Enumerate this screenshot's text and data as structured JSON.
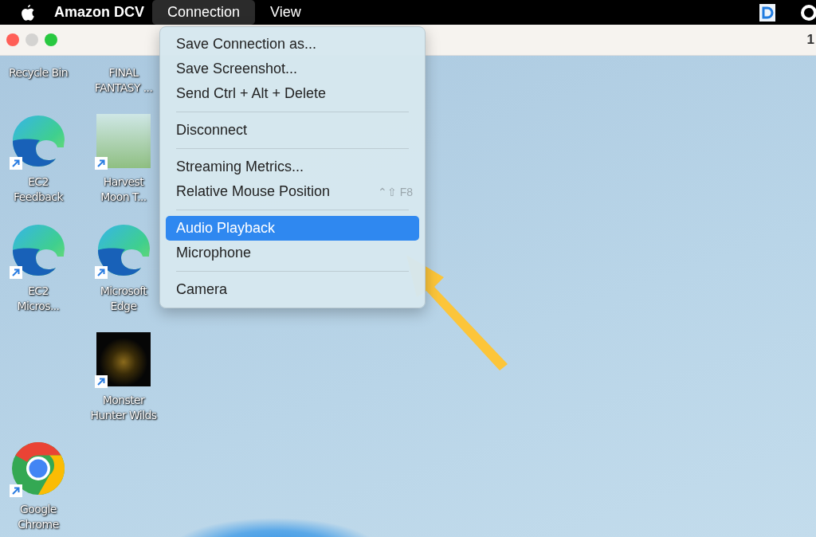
{
  "menubar": {
    "app_name": "Amazon DCV",
    "menus": [
      {
        "label": "Connection",
        "selected": true
      },
      {
        "label": "View",
        "selected": false
      }
    ]
  },
  "titlebar": {
    "right_text": "1"
  },
  "desktop": {
    "shortcuts": [
      {
        "label": "Recycle Bin",
        "kind": "clipped"
      },
      {
        "label": "FINAL\nFANTASY ...",
        "kind": "clipped"
      },
      {
        "label": "EC2\nFeedback",
        "kind": "edge"
      },
      {
        "label": "Harvest\nMoon T...",
        "kind": "photo"
      },
      {
        "label": "EC2\nMicros...",
        "kind": "edge"
      },
      {
        "label": "Microsoft\nEdge",
        "kind": "edge"
      },
      {
        "label": "Monster\nHunter Wilds",
        "kind": "darkphoto"
      },
      {
        "label": "Google\nChrome",
        "kind": "chrome"
      }
    ]
  },
  "menu": {
    "items": [
      {
        "kind": "item",
        "label": "Save Connection as...",
        "selected": false
      },
      {
        "kind": "item",
        "label": "Save Screenshot...",
        "selected": false
      },
      {
        "kind": "item",
        "label": "Send Ctrl + Alt + Delete",
        "selected": false
      },
      {
        "kind": "separator"
      },
      {
        "kind": "item",
        "label": "Disconnect",
        "selected": false
      },
      {
        "kind": "separator"
      },
      {
        "kind": "item",
        "label": "Streaming Metrics...",
        "selected": false
      },
      {
        "kind": "item",
        "label": "Relative Mouse Position",
        "shortcut": "⌃⇧ F8",
        "selected": false
      },
      {
        "kind": "separator"
      },
      {
        "kind": "item",
        "label": "Audio Playback",
        "selected": true
      },
      {
        "kind": "item",
        "label": "Microphone",
        "selected": false
      },
      {
        "kind": "separator"
      },
      {
        "kind": "item",
        "label": "Camera",
        "selected": false
      }
    ]
  }
}
